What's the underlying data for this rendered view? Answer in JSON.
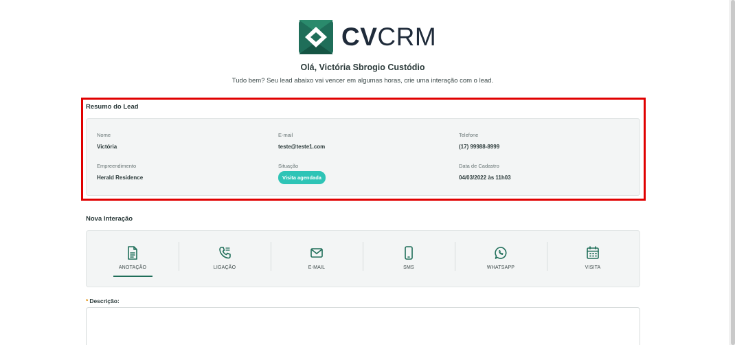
{
  "brand": {
    "name_bold": "CV",
    "name_regular": "CRM",
    "logo_icon": "cvcrm-logo-icon",
    "colors": {
      "primary": "#1f6e59",
      "accent": "#2ec4b6",
      "highlight": "#e00000"
    }
  },
  "header": {
    "greeting": "Olá, Victória Sbrogio Custódio",
    "subtitle": "Tudo bem? Seu lead abaixo vai vencer em algumas horas, crie uma interação com o lead."
  },
  "summary": {
    "title": "Resumo do Lead",
    "fields": {
      "nome_label": "Nome",
      "nome_value": "Victória",
      "email_label": "E-mail",
      "email_value": "teste@teste1.com",
      "telefone_label": "Telefone",
      "telefone_value": "(17) 99988-8999",
      "empreendimento_label": "Empreendimento",
      "empreendimento_value": "Herald Residence",
      "situacao_label": "Situação",
      "situacao_value": "Visita agendada",
      "data_label": "Data de Cadastro",
      "data_value": "04/03/2022 às 11h03"
    }
  },
  "interaction": {
    "title": "Nova Interação",
    "tabs": [
      {
        "label": "ANOTAÇÃO",
        "icon": "document-icon",
        "active": true
      },
      {
        "label": "LIGAÇÃO",
        "icon": "phone-icon",
        "active": false
      },
      {
        "label": "E-MAIL",
        "icon": "envelope-icon",
        "active": false
      },
      {
        "label": "SMS",
        "icon": "mobile-icon",
        "active": false
      },
      {
        "label": "WHATSAPP",
        "icon": "whatsapp-icon",
        "active": false
      },
      {
        "label": "VISITA",
        "icon": "calendar-icon",
        "active": false
      }
    ],
    "description_required_mark": "*",
    "description_label": "Descrição:"
  }
}
